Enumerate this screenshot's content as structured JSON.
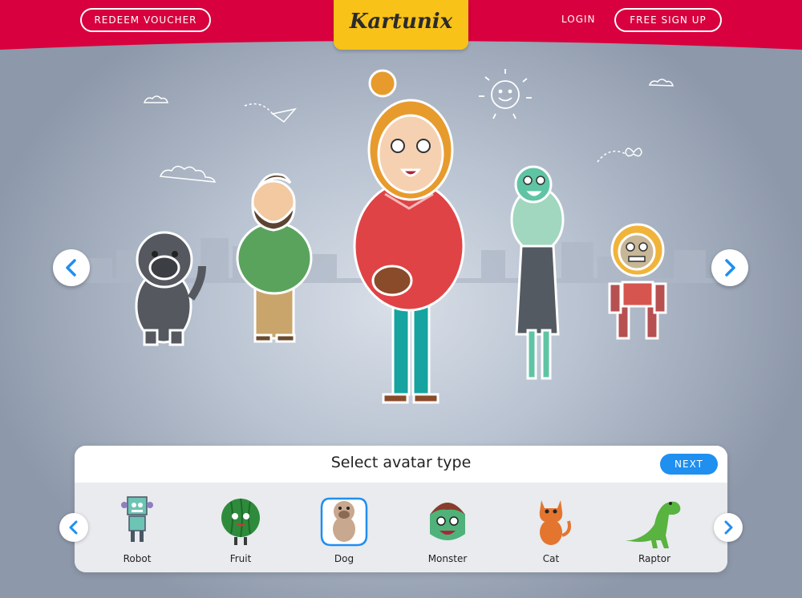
{
  "header": {
    "redeem_label": "REDEEM VOUCHER",
    "logo_text": "Kartunix",
    "login_label": "LOGIN",
    "signup_label": "FREE SIGN UP"
  },
  "carousel": {
    "characters": [
      "pug-dog",
      "bearded-man",
      "girl-in-sweater",
      "zombie-woman",
      "robot"
    ],
    "selected": "girl-in-sweater"
  },
  "selector": {
    "title": "Select avatar type",
    "next_label": "NEXT",
    "types": [
      {
        "label": "Robot",
        "icon": "robot-icon"
      },
      {
        "label": "Fruit",
        "icon": "watermelon-icon"
      },
      {
        "label": "Dog",
        "icon": "dog-icon"
      },
      {
        "label": "Monster",
        "icon": "monster-icon"
      },
      {
        "label": "Cat",
        "icon": "cat-icon"
      },
      {
        "label": "Raptor",
        "icon": "dinosaur-icon"
      }
    ],
    "selected": "Dog"
  },
  "colors": {
    "header_red": "#d8003e",
    "logo_yellow": "#f8c218",
    "accent_blue": "#1f8ff0"
  }
}
